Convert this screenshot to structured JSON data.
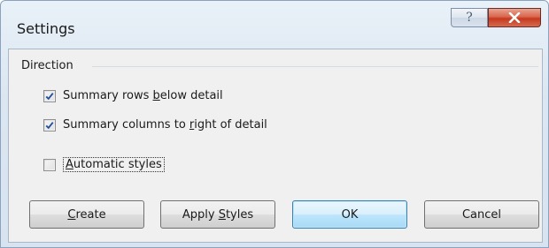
{
  "window": {
    "title": "Settings",
    "help_symbol": "?",
    "close_icon": "close-icon"
  },
  "group": {
    "label": "Direction"
  },
  "checkboxes": [
    {
      "pre": "Summary rows ",
      "mn": "b",
      "post": "elow detail",
      "checked": true
    },
    {
      "pre": "Summary columns to ",
      "mn": "r",
      "post": "ight of detail",
      "checked": true
    },
    {
      "pre": "",
      "mn": "A",
      "post": "utomatic styles",
      "checked": false
    }
  ],
  "buttons": {
    "create": {
      "pre": "",
      "mn": "C",
      "post": "reate"
    },
    "apply_styles": {
      "pre": "Apply ",
      "mn": "S",
      "post": "tyles"
    },
    "ok": {
      "label": "OK"
    },
    "cancel": {
      "label": "Cancel"
    }
  },
  "colors": {
    "check": "#1f4e9e",
    "close_button": "#c5391f",
    "default_button_border": "#3c7fb1"
  }
}
